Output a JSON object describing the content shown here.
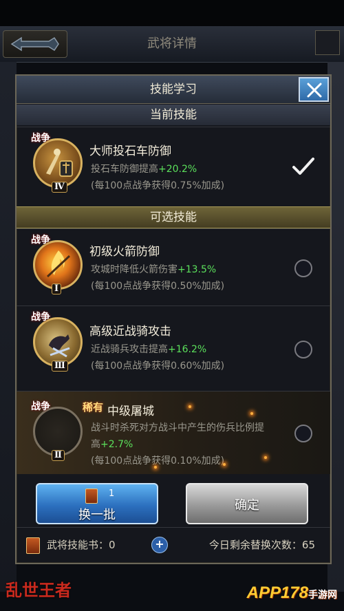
{
  "header": {
    "title": "武将详情"
  },
  "dialog": {
    "title": "技能学习",
    "current_section": "当前技能",
    "available_section": "可选技能"
  },
  "skills": {
    "current": {
      "tag": "战争",
      "level": "Ⅳ",
      "name": "大师投石车防御",
      "desc_prefix": "投石车防御提高",
      "desc_value": "+20.2%",
      "rate": "(每100点战争获得0.75%加成)",
      "selected": true
    },
    "options": [
      {
        "tag": "战争",
        "level": "Ⅰ",
        "name": "初级火箭防御",
        "desc_prefix": "攻城时降低火箭伤害",
        "desc_value": "+13.5%",
        "rate": "(每100点战争获得0.50%加成)",
        "selected": false
      },
      {
        "tag": "战争",
        "level": "Ⅲ",
        "name": "高级近战骑攻击",
        "desc_prefix": "近战骑兵攻击提高",
        "desc_value": "+16.2%",
        "rate": "(每100点战争获得0.60%加成)",
        "selected": false
      },
      {
        "tag": "战争",
        "level": "Ⅱ",
        "hot_tag": "稀有",
        "name": "中级屠城",
        "desc_prefix": "战斗时杀死对方战斗中产生的伤兵比例提",
        "desc_line2_prefix": "高",
        "desc_value": "+2.7%",
        "rate": "(每100点战争获得0.10%加成)",
        "selected": false
      }
    ]
  },
  "buttons": {
    "refresh_label": "换一批",
    "refresh_cost": "1",
    "confirm_label": "确定"
  },
  "footer": {
    "book_label": "武将技能书：",
    "book_count": "0",
    "plus_label": "+",
    "remaining_label": "今日剩余替换次数：",
    "remaining_count": "65"
  },
  "watermark": {
    "left_logo": "乱世王者",
    "right_logo": "APP178",
    "right_sub": "手游网"
  },
  "colors": {
    "highlight": "#5be05b",
    "refresh_button": "#2c70bf",
    "confirm_button": "#9a9a9a",
    "frame_gold": "#d8b260"
  }
}
